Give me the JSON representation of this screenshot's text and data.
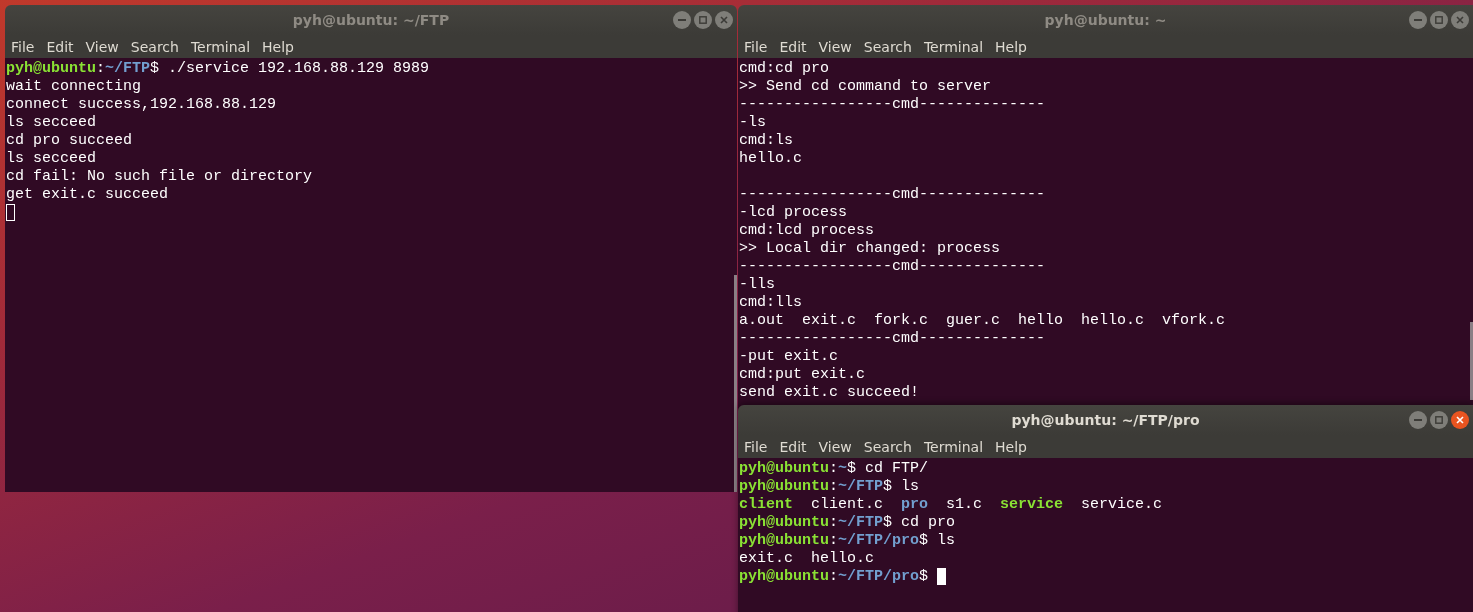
{
  "windows": [
    {
      "title": "pyh@ubuntu: ~/FTP",
      "focused": false,
      "menu": [
        "File",
        "Edit",
        "View",
        "Search",
        "Terminal",
        "Help"
      ],
      "lines": [
        {
          "kind": "text",
          "segments": [
            {
              "kind": "user",
              "text": "pyh@ubuntu"
            },
            {
              "kind": "plain",
              "text": ":"
            },
            {
              "kind": "path",
              "text": "~/FTP"
            },
            {
              "kind": "plain",
              "text": "$ ./service 192.168.88.129 8989"
            }
          ]
        },
        {
          "kind": "text",
          "segments": [
            {
              "kind": "plain",
              "text": "wait connecting"
            }
          ]
        },
        {
          "kind": "text",
          "segments": [
            {
              "kind": "plain",
              "text": "connect success,192.168.88.129"
            }
          ]
        },
        {
          "kind": "text",
          "segments": [
            {
              "kind": "plain",
              "text": "ls secceed"
            }
          ]
        },
        {
          "kind": "text",
          "segments": [
            {
              "kind": "plain",
              "text": "cd pro succeed"
            }
          ]
        },
        {
          "kind": "text",
          "segments": [
            {
              "kind": "plain",
              "text": "ls secceed"
            }
          ]
        },
        {
          "kind": "text",
          "segments": [
            {
              "kind": "plain",
              "text": "cd fail: No such file or directory"
            }
          ]
        },
        {
          "kind": "text",
          "segments": [
            {
              "kind": "plain",
              "text": "get exit.c succeed"
            }
          ]
        },
        {
          "kind": "text",
          "segments": [
            {
              "kind": "cursor"
            }
          ]
        }
      ]
    },
    {
      "title": "pyh@ubuntu: ~",
      "focused": false,
      "menu": [
        "File",
        "Edit",
        "View",
        "Search",
        "Terminal",
        "Help"
      ],
      "lines": [
        {
          "kind": "text",
          "segments": [
            {
              "kind": "plain",
              "text": "cmd:cd pro"
            }
          ]
        },
        {
          "kind": "text",
          "segments": [
            {
              "kind": "plain",
              "text": ">> Send cd command to server"
            }
          ]
        },
        {
          "kind": "text",
          "segments": [
            {
              "kind": "plain",
              "text": "-----------------cmd--------------"
            }
          ]
        },
        {
          "kind": "text",
          "segments": [
            {
              "kind": "plain",
              "text": "-ls"
            }
          ]
        },
        {
          "kind": "text",
          "segments": [
            {
              "kind": "plain",
              "text": "cmd:ls"
            }
          ]
        },
        {
          "kind": "text",
          "segments": [
            {
              "kind": "plain",
              "text": "hello.c"
            }
          ]
        },
        {
          "kind": "blank"
        },
        {
          "kind": "text",
          "segments": [
            {
              "kind": "plain",
              "text": "-----------------cmd--------------"
            }
          ]
        },
        {
          "kind": "text",
          "segments": [
            {
              "kind": "plain",
              "text": "-lcd process"
            }
          ]
        },
        {
          "kind": "text",
          "segments": [
            {
              "kind": "plain",
              "text": "cmd:lcd process"
            }
          ]
        },
        {
          "kind": "text",
          "segments": [
            {
              "kind": "plain",
              "text": ">> Local dir changed: process"
            }
          ]
        },
        {
          "kind": "text",
          "segments": [
            {
              "kind": "plain",
              "text": "-----------------cmd--------------"
            }
          ]
        },
        {
          "kind": "text",
          "segments": [
            {
              "kind": "plain",
              "text": "-lls"
            }
          ]
        },
        {
          "kind": "text",
          "segments": [
            {
              "kind": "plain",
              "text": "cmd:lls"
            }
          ]
        },
        {
          "kind": "text",
          "segments": [
            {
              "kind": "plain",
              "text": "a.out  exit.c  fork.c  guer.c  hello  hello.c  vfork.c"
            }
          ]
        },
        {
          "kind": "text",
          "segments": [
            {
              "kind": "plain",
              "text": "-----------------cmd--------------"
            }
          ]
        },
        {
          "kind": "text",
          "segments": [
            {
              "kind": "plain",
              "text": "-put exit.c"
            }
          ]
        },
        {
          "kind": "text",
          "segments": [
            {
              "kind": "plain",
              "text": "cmd:put exit.c"
            }
          ]
        },
        {
          "kind": "text",
          "segments": [
            {
              "kind": "plain",
              "text": "send exit.c succeed!"
            }
          ]
        }
      ]
    },
    {
      "title": "pyh@ubuntu: ~/FTP/pro",
      "focused": true,
      "menu": [
        "File",
        "Edit",
        "View",
        "Search",
        "Terminal",
        "Help"
      ],
      "lines": [
        {
          "kind": "text",
          "segments": [
            {
              "kind": "user",
              "text": "pyh@ubuntu"
            },
            {
              "kind": "plain",
              "text": ":"
            },
            {
              "kind": "path",
              "text": "~"
            },
            {
              "kind": "plain",
              "text": "$ cd FTP/"
            }
          ]
        },
        {
          "kind": "text",
          "segments": [
            {
              "kind": "user",
              "text": "pyh@ubuntu"
            },
            {
              "kind": "plain",
              "text": ":"
            },
            {
              "kind": "path",
              "text": "~/FTP"
            },
            {
              "kind": "plain",
              "text": "$ ls"
            }
          ]
        },
        {
          "kind": "text",
          "segments": [
            {
              "kind": "exec",
              "text": "client"
            },
            {
              "kind": "plain",
              "text": "  client.c  "
            },
            {
              "kind": "dir",
              "text": "pro"
            },
            {
              "kind": "plain",
              "text": "  s1.c  "
            },
            {
              "kind": "exec",
              "text": "service"
            },
            {
              "kind": "plain",
              "text": "  service.c"
            }
          ]
        },
        {
          "kind": "text",
          "segments": [
            {
              "kind": "user",
              "text": "pyh@ubuntu"
            },
            {
              "kind": "plain",
              "text": ":"
            },
            {
              "kind": "path",
              "text": "~/FTP"
            },
            {
              "kind": "plain",
              "text": "$ cd pro"
            }
          ]
        },
        {
          "kind": "text",
          "segments": [
            {
              "kind": "user",
              "text": "pyh@ubuntu"
            },
            {
              "kind": "plain",
              "text": ":"
            },
            {
              "kind": "path",
              "text": "~/FTP/pro"
            },
            {
              "kind": "plain",
              "text": "$ ls"
            }
          ]
        },
        {
          "kind": "text",
          "segments": [
            {
              "kind": "plain",
              "text": "exit.c  hello.c"
            }
          ]
        },
        {
          "kind": "text",
          "segments": [
            {
              "kind": "user",
              "text": "pyh@ubuntu"
            },
            {
              "kind": "plain",
              "text": ":"
            },
            {
              "kind": "path",
              "text": "~/FTP/pro"
            },
            {
              "kind": "plain",
              "text": "$ "
            },
            {
              "kind": "cursor"
            }
          ]
        }
      ]
    }
  ]
}
